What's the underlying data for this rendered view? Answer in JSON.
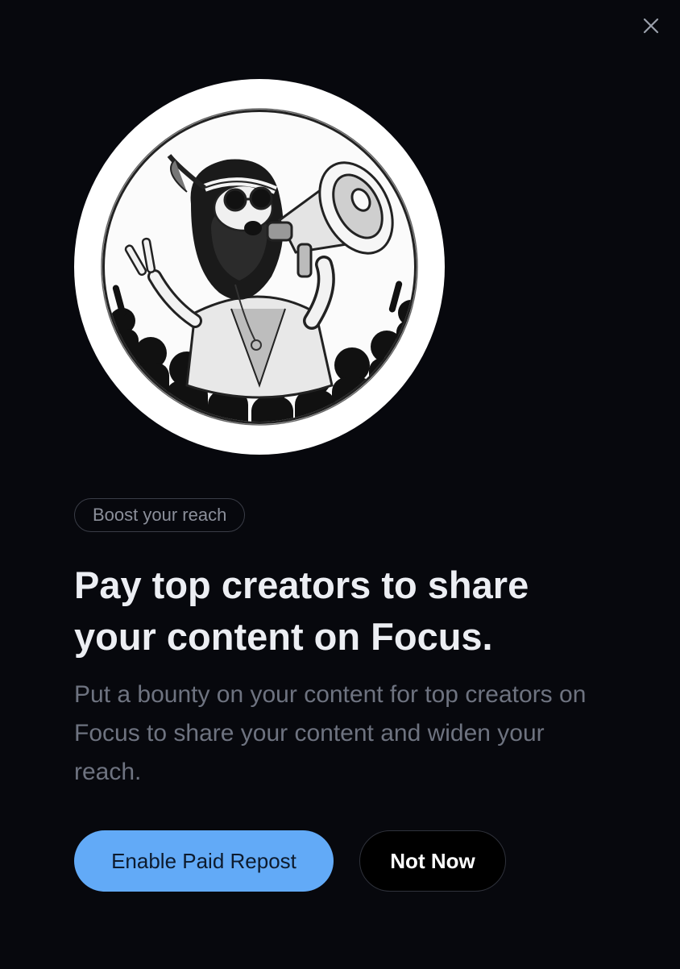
{
  "modal": {
    "close_icon": "close-icon",
    "hero_icon": "megaphone-hippie-illustration",
    "badge": "Boost your reach",
    "headline": "Pay top creators to share your content on Focus.",
    "subtext": "Put a bounty on your content for top creators on Focus to share your content and widen your reach.",
    "primary_button": "Enable Paid Repost",
    "secondary_button": "Not Now"
  },
  "colors": {
    "background": "#07080d",
    "primary_button": "#62aaf7",
    "primary_button_text": "#0d1b2e",
    "headline": "#eceef3",
    "subtext": "#6e7380",
    "badge_border": "#3a3d47",
    "badge_text": "#8b8f9a"
  }
}
